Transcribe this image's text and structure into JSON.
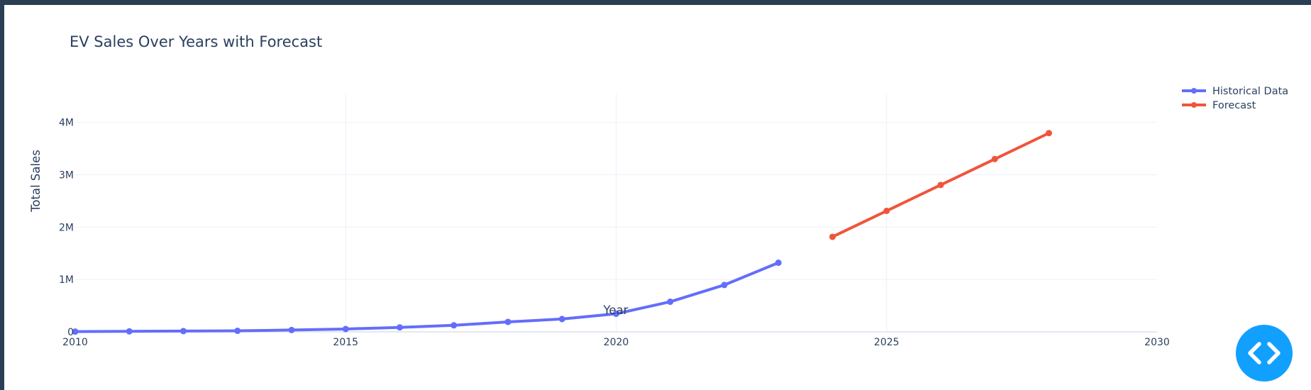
{
  "chart_data": {
    "type": "line",
    "title": "EV Sales Over Years with Forecast",
    "xlabel": "Year",
    "ylabel": "Total Sales",
    "xlim": [
      2010,
      2030
    ],
    "ylim": [
      0,
      4550000
    ],
    "x_ticks": [
      2010,
      2015,
      2020,
      2025,
      2030
    ],
    "x_tick_labels": [
      "2010",
      "2015",
      "2020",
      "2025",
      "2030"
    ],
    "y_ticks": [
      0,
      1000000,
      2000000,
      3000000,
      4000000
    ],
    "y_tick_labels": [
      "0",
      "1M",
      "2M",
      "3M",
      "4M"
    ],
    "grid": true,
    "legend_position": "top-right",
    "series": [
      {
        "name": "Historical Data",
        "color": "#636efa",
        "x": [
          2010,
          2011,
          2012,
          2013,
          2014,
          2015,
          2016,
          2017,
          2018,
          2019,
          2020,
          2021,
          2022,
          2023
        ],
        "y": [
          5000,
          10000,
          15000,
          20000,
          35000,
          55000,
          85000,
          125000,
          190000,
          245000,
          345000,
          575000,
          895000,
          1320000
        ]
      },
      {
        "name": "Forecast",
        "color": "#ef553b",
        "x": [
          2024,
          2025,
          2026,
          2027,
          2028
        ],
        "y": [
          1815000,
          2310000,
          2805000,
          3300000,
          3795000
        ]
      }
    ]
  },
  "code_button": {
    "icon": "code-brackets-icon",
    "color": "#12a0ff"
  }
}
